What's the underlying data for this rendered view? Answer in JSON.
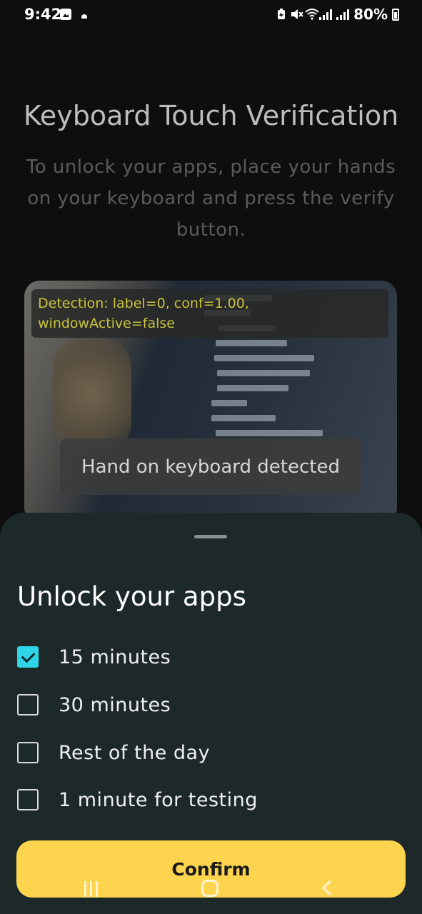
{
  "status_bar": {
    "time": "9:42",
    "battery": "80%",
    "icons": [
      "image-icon",
      "notification-dot-icon",
      "battery-saver-icon",
      "mute-icon",
      "wifi-icon",
      "signal-icon",
      "signal-icon",
      "battery-icon"
    ]
  },
  "page": {
    "title": "Keyboard Touch Verification",
    "subtitle": "To unlock your apps, place your hands on your keyboard and press the verify button."
  },
  "preview": {
    "detection_text": "Detection: label=0, conf=1.00, windowActive=false",
    "hand_status": "Hand on keyboard detected"
  },
  "sheet": {
    "title": "Unlock your apps",
    "options": [
      {
        "label": "15 minutes",
        "checked": true
      },
      {
        "label": "30 minutes",
        "checked": false
      },
      {
        "label": "Rest of the day",
        "checked": false
      },
      {
        "label": "1 minute for testing",
        "checked": false
      }
    ],
    "confirm_label": "Confirm"
  },
  "colors": {
    "sheet_background": "#1d2828",
    "checkbox_accent": "#2fd4e6",
    "confirm_button": "#fdd44e",
    "detection_text": "#c9c43b"
  },
  "nav_bar": {
    "icons": [
      "recent-apps-icon",
      "home-icon",
      "back-icon"
    ]
  }
}
